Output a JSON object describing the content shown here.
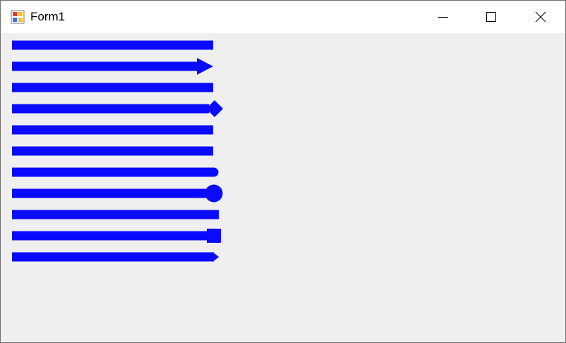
{
  "window": {
    "title": "Form1"
  },
  "icons": {
    "app": "form-app-icon",
    "minimize": "minimize-icon",
    "maximize": "maximize-icon",
    "close": "close-icon"
  },
  "colors": {
    "line": "#0a0aff",
    "client_background": "#efefef",
    "titlebar_background": "#ffffff"
  },
  "lines": [
    {
      "cap": "flat"
    },
    {
      "cap": "arrow"
    },
    {
      "cap": "flat"
    },
    {
      "cap": "diamond"
    },
    {
      "cap": "flat"
    },
    {
      "cap": "flat"
    },
    {
      "cap": "round"
    },
    {
      "cap": "round-anchor"
    },
    {
      "cap": "square"
    },
    {
      "cap": "square-anchor"
    },
    {
      "cap": "triangle"
    }
  ]
}
